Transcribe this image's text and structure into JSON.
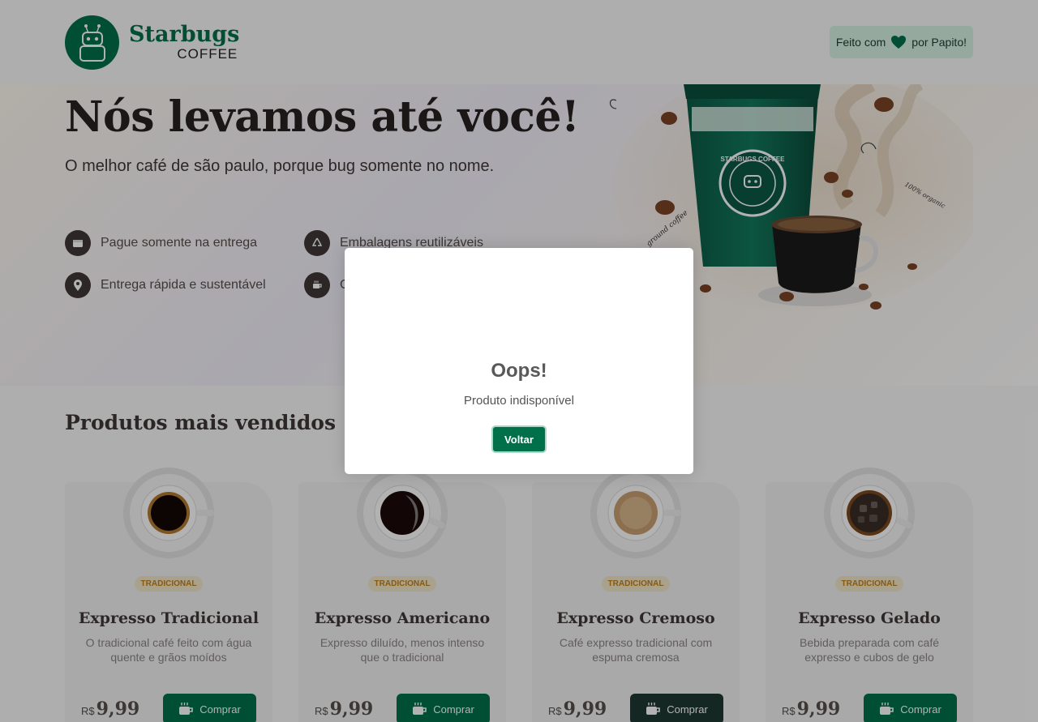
{
  "header": {
    "brand": "Starbugs",
    "brand_sub": "COFFEE",
    "made_by_prefix": "Feito com",
    "made_by_suffix": "por Papito!"
  },
  "hero": {
    "title": "Nós levamos até você!",
    "subtitle": "O melhor café de são paulo, porque bug somente no nome.",
    "features": [
      {
        "icon": "wallet-icon",
        "label": "Pague somente na entrega"
      },
      {
        "icon": "recycle-icon",
        "label": "Embalagens reutilizáveis"
      },
      {
        "icon": "map-pin-icon",
        "label": "Entrega rápida e sustentável"
      },
      {
        "icon": "coffee-icon",
        "label": "C"
      }
    ],
    "cup_brand": "STARBUGS COFFEE",
    "art_labels": [
      "ground coffee",
      "100% organic"
    ]
  },
  "products": {
    "title": "Produtos mais vendidos",
    "currency": "R$",
    "items": [
      {
        "tag": "TRADICIONAL",
        "name": "Expresso Tradicional",
        "desc": "O tradicional café feito com água quente e grãos moídos",
        "price": "9,99",
        "buy": "Comprar"
      },
      {
        "tag": "TRADICIONAL",
        "name": "Expresso Americano",
        "desc": "Expresso diluído, menos intenso que o tradicional",
        "price": "9,99",
        "buy": "Comprar"
      },
      {
        "tag": "TRADICIONAL",
        "name": "Expresso Cremoso",
        "desc": "Café expresso tradicional com espuma cremosa",
        "price": "9,99",
        "buy": "Comprar"
      },
      {
        "tag": "TRADICIONAL",
        "name": "Expresso Gelado",
        "desc": "Bebida preparada com café expresso e cubos de gelo",
        "price": "9,99",
        "buy": "Comprar"
      }
    ]
  },
  "modal": {
    "title": "Oops!",
    "text": "Produto indisponível",
    "button": "Voltar"
  },
  "colors": {
    "brand_green": "#00704a",
    "dark_green": "#1e3932",
    "tag_bg": "#f1e9c9",
    "tag_text": "#c47f17"
  }
}
